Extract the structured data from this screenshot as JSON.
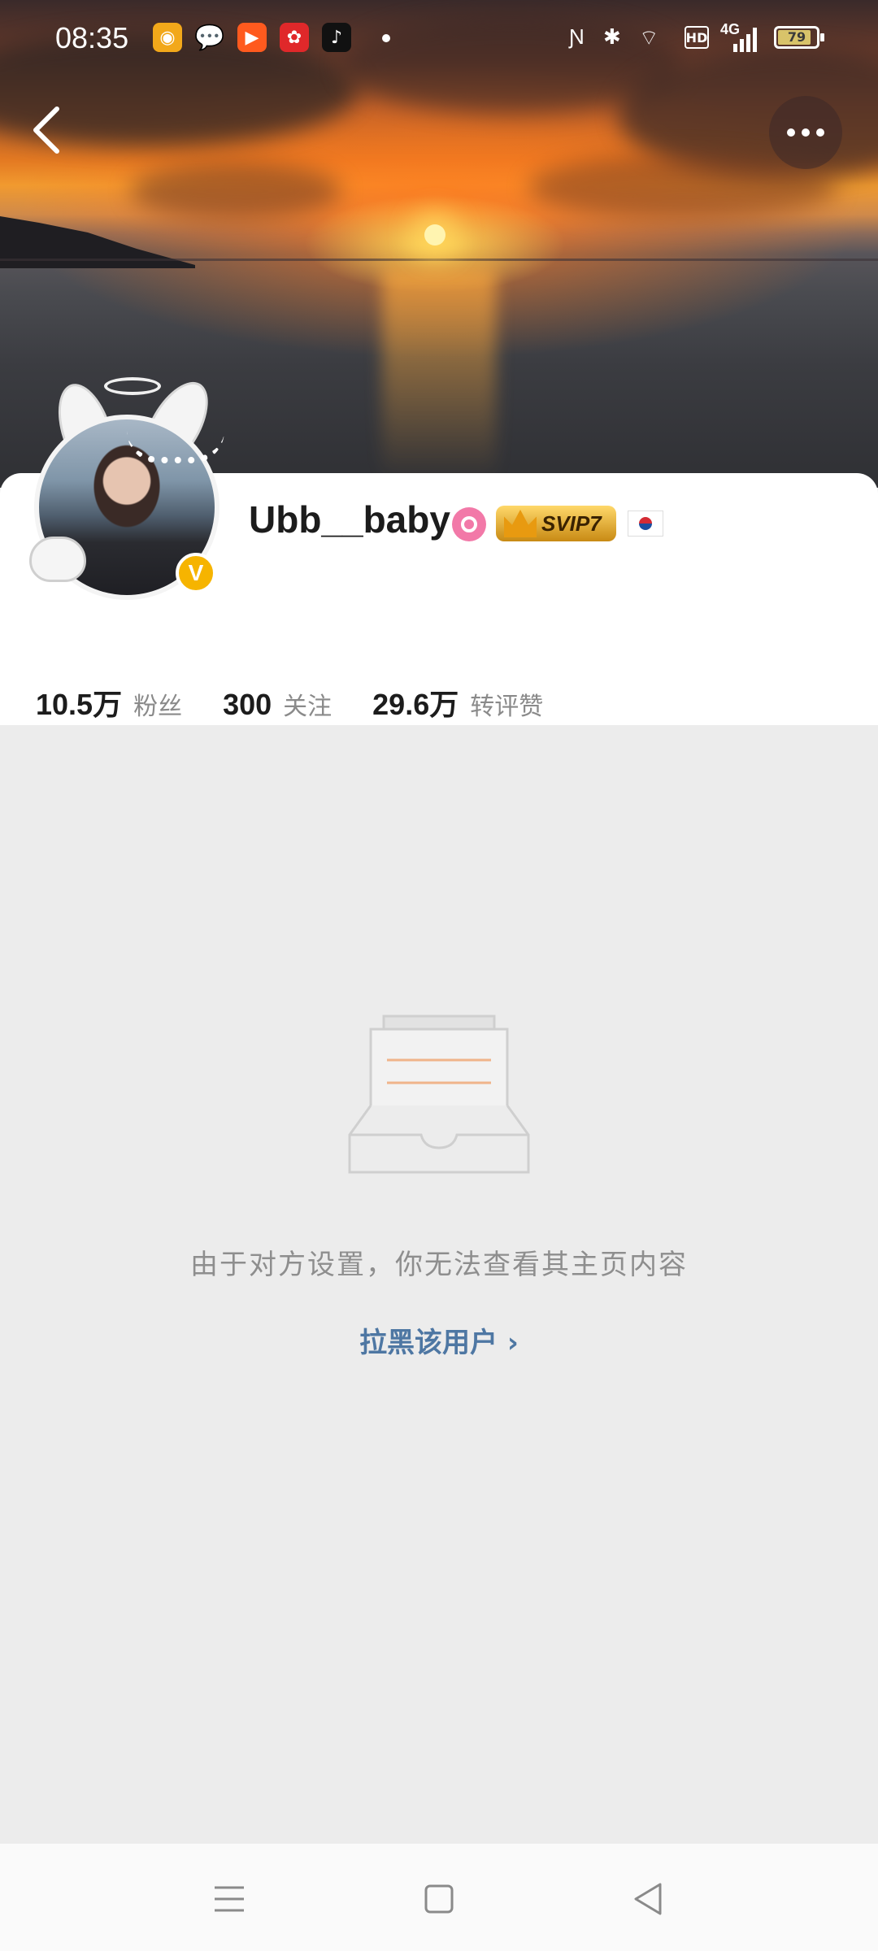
{
  "status_bar": {
    "time": "08:35",
    "network": "4G",
    "hd_label": "HD",
    "battery": "79"
  },
  "profile": {
    "name": "Ubb__baby",
    "verified_badge": "V",
    "vip_label": "SVIP7",
    "stats": [
      {
        "value": "10.5万",
        "label": "粉丝"
      },
      {
        "value": "300",
        "label": "关注"
      },
      {
        "value": "29.6万",
        "label": "转评赞"
      }
    ]
  },
  "empty_state": {
    "message": "由于对方设置，你无法查看其主页内容",
    "block_link": "拉黑该用户"
  },
  "colors": {
    "link": "#4e77a3",
    "vip_gold": "#e8a010",
    "gender_pink": "#f279a8",
    "verified_yellow": "#f6b400"
  }
}
